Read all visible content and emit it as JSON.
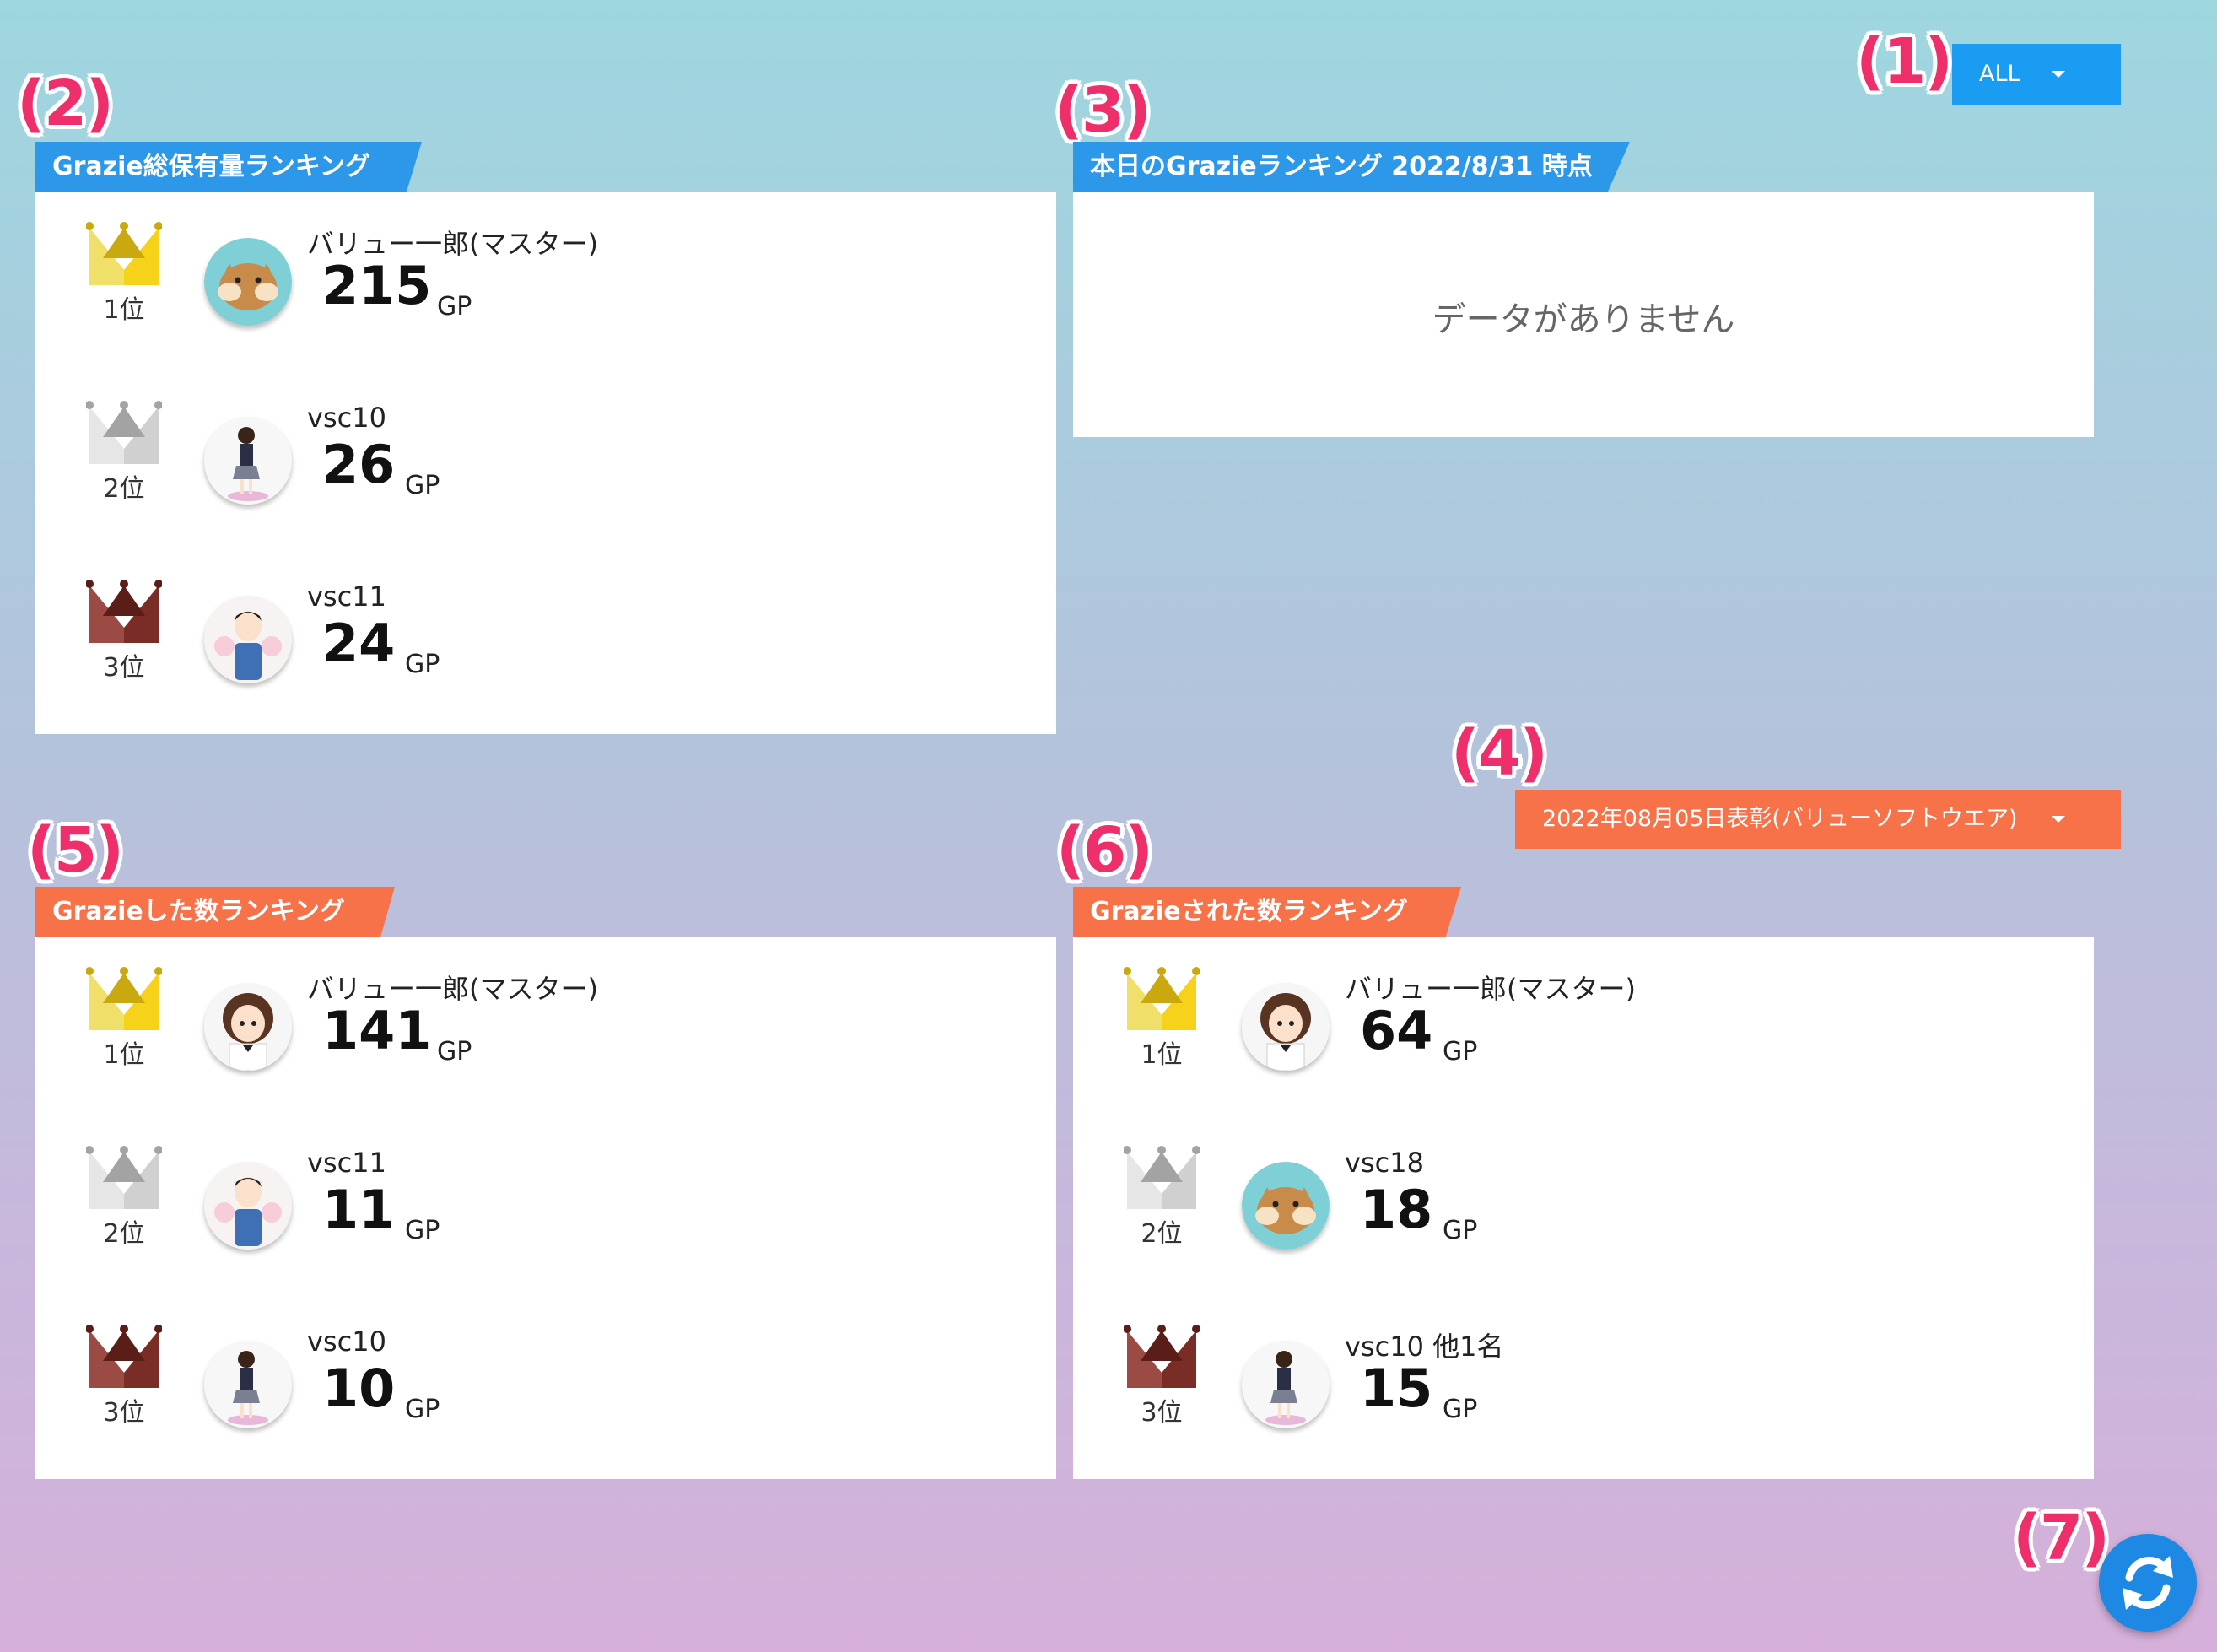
{
  "annotations": [
    "(1)",
    "(2)",
    "(3)",
    "(4)",
    "(5)",
    "(6)",
    "(7)"
  ],
  "filter": {
    "label": "ALL"
  },
  "period_select": {
    "label": "2022年08月05日表彰(バリューソフトウエア)"
  },
  "colors": {
    "blue": "#2d97ea",
    "orange": "#f77149",
    "gold": "#f7d21a",
    "silver": "#d4d4d4",
    "bronze": "#7a2d27",
    "fab": "#1e88e5"
  },
  "unit": "GP",
  "total_ranking": {
    "title": "Grazie総保有量ランキング",
    "entries": [
      {
        "rank": "1位",
        "name": "バリュー一郎(マスター)",
        "points": "215",
        "avatar": "chipmunk-avatar-icon"
      },
      {
        "rank": "2位",
        "name": "vsc10",
        "points": "26",
        "avatar": "schoolgirl-avatar-icon"
      },
      {
        "rank": "3位",
        "name": "vsc11",
        "points": "24",
        "avatar": "boy-avatar-icon"
      }
    ]
  },
  "today_ranking": {
    "title": "本日のGrazieランキング 2022/8/31 時点",
    "empty_text": "データがありません"
  },
  "given_ranking": {
    "title": "Grazieした数ランキング",
    "entries": [
      {
        "rank": "1位",
        "name": "バリュー一郎(マスター)",
        "points": "141",
        "avatar": "girl-avatar-icon"
      },
      {
        "rank": "2位",
        "name": "vsc11",
        "points": "11",
        "avatar": "boy-avatar-icon"
      },
      {
        "rank": "3位",
        "name": "vsc10",
        "points": "10",
        "avatar": "schoolgirl-avatar-icon"
      }
    ]
  },
  "received_ranking": {
    "title": "Grazieされた数ランキング",
    "entries": [
      {
        "rank": "1位",
        "name": "バリュー一郎(マスター)",
        "points": "64",
        "avatar": "girl-avatar-icon"
      },
      {
        "rank": "2位",
        "name": "vsc18",
        "points": "18",
        "avatar": "chipmunk-avatar-icon"
      },
      {
        "rank": "3位",
        "name": "vsc10 他1名",
        "points": "15",
        "avatar": "schoolgirl-avatar-icon"
      }
    ]
  },
  "refresh": {
    "icon": "refresh-icon"
  }
}
